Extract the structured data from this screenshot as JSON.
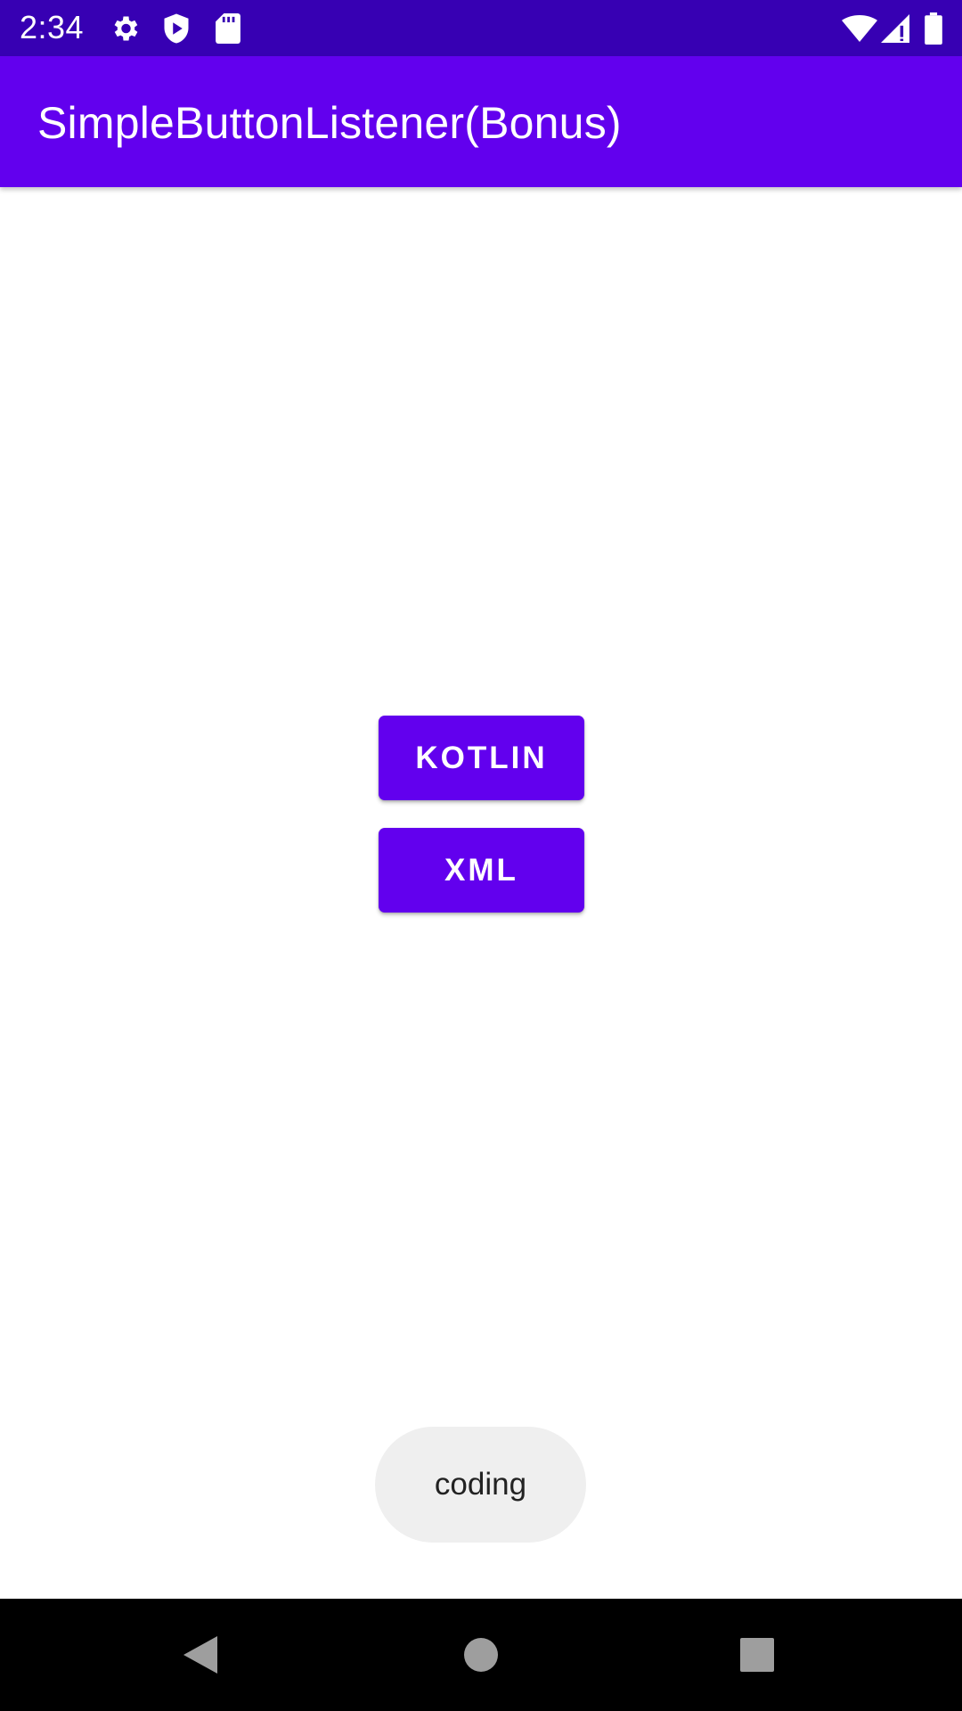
{
  "status_bar": {
    "time": "2:34",
    "icons": [
      "gear-icon",
      "shield-play-icon",
      "sd-card-icon",
      "wifi-icon",
      "signal-icon",
      "battery-icon"
    ],
    "background": "#3700b3"
  },
  "app_bar": {
    "title": "SimpleButtonListener(Bonus)",
    "background": "#6200ee"
  },
  "buttons": {
    "kotlin_label": "KOTLIN",
    "xml_label": "XML",
    "color": "#6200ee"
  },
  "toast": {
    "message": "coding"
  },
  "nav_bar": {
    "icons": [
      "back-icon",
      "home-icon",
      "recents-icon"
    ]
  }
}
